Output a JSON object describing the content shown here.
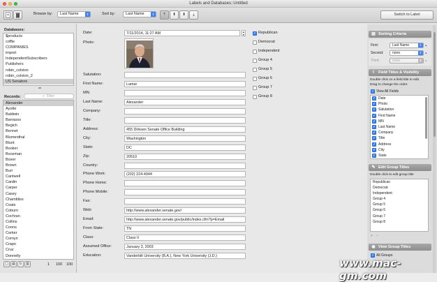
{
  "window": {
    "title": "Labels and Databases::Untitled"
  },
  "toolbar": {
    "browse_by_label": "Browse by:",
    "browse_by_value": "Last Name",
    "sort_by_label": "Sort by:",
    "sort_by_value": "Last Name",
    "switch_label": "Switch to Label"
  },
  "databases": {
    "header": "Databases:",
    "items": [
      "$products",
      "coffie",
      "COMPANIES",
      "import",
      "IndependentSubscribers",
      "Publishers",
      "robin_colston",
      "robin_colston_2",
      "US Senators"
    ],
    "selected": "US Senators"
  },
  "records": {
    "header": "Records:",
    "filter_placeholder": "Filter",
    "items": [
      "Alexander",
      "Ayotte",
      "Baldwin",
      "Barrasso",
      "Begich",
      "Bennet",
      "Blumenthal",
      "Blunt",
      "Booker",
      "Boozman",
      "Boxer",
      "Brown",
      "Burr",
      "Cantwell",
      "Cardin",
      "Carper",
      "Casey",
      "Chambliss",
      "Coats",
      "Coburn",
      "Cochran",
      "Collins",
      "Coons",
      "Corker",
      "Cornyn",
      "Crapo",
      "Cruz",
      "Donnelly"
    ],
    "selected": "Alexander",
    "footer": {
      "count": "1",
      "total": "100",
      "of": "100"
    }
  },
  "record": {
    "date_label": "Date:",
    "date_value": "7/11/2014, 11:27 AM",
    "photo_label": "Photo:",
    "fields": [
      {
        "label": "Salutation:",
        "value": ""
      },
      {
        "label": "First Name:",
        "value": "Lamar"
      },
      {
        "label": "MN:",
        "value": ""
      },
      {
        "label": "Last Name:",
        "value": "Alexander"
      },
      {
        "label": "Company:",
        "value": ""
      },
      {
        "label": "Title:",
        "value": ""
      },
      {
        "label": "Address:",
        "value": "455 Dirksen Senate Office Building"
      },
      {
        "label": "City:",
        "value": "Washington"
      },
      {
        "label": "State:",
        "value": "DC"
      },
      {
        "label": "Zip:",
        "value": "20510"
      },
      {
        "label": "Country:",
        "value": ""
      },
      {
        "label": "Phone Work:",
        "value": "(202) 224-4944"
      },
      {
        "label": "Phone Home:",
        "value": ""
      },
      {
        "label": "Phone Mobile:",
        "value": ""
      },
      {
        "label": "Fax:",
        "value": ""
      },
      {
        "label": "Web:",
        "value": "http://www.alexander.senate.gov/"
      },
      {
        "label": "Email:",
        "value": "http://www.alexander.senate.gov/public/index.cfm?p=Email"
      },
      {
        "label": "From State:",
        "value": "TN"
      },
      {
        "label": "Class:",
        "value": "Class II"
      },
      {
        "label": "Assumed Office:",
        "value": "January 3, 2003"
      },
      {
        "label": "Education:",
        "value": "Vanderbilt University (B.A.), New York University (J.D.)"
      }
    ],
    "groups": [
      {
        "label": "Republican",
        "checked": true
      },
      {
        "label": "Democrat",
        "checked": false
      },
      {
        "label": "Independent",
        "checked": false
      },
      {
        "label": "Group 4",
        "checked": false
      },
      {
        "label": "Group 5",
        "checked": false
      },
      {
        "label": "Group 6",
        "checked": false
      },
      {
        "label": "Group 7",
        "checked": false
      },
      {
        "label": "Group 8",
        "checked": false
      }
    ]
  },
  "right": {
    "sorting": {
      "header": "Sorting Criteria",
      "first_label": "First:",
      "first_value": "Last Name",
      "second_label": "Second:",
      "second_value": "none",
      "third_label": "Third:",
      "third_value": "none"
    },
    "field_titles": {
      "header": "Field Titles & Visibility",
      "help1": "Double click on a field title to edit.",
      "help2": "Drag to change the order.",
      "view_all": "View All Fields",
      "items": [
        "Date",
        "Photo",
        "Salutation",
        "First Name",
        "MN",
        "Last Name",
        "Company",
        "Title",
        "Address",
        "City",
        "State"
      ]
    },
    "group_titles": {
      "header": "Edit Group Titles",
      "help": "Double click to edit group title",
      "items": [
        "Republican",
        "Democrat",
        "Independent",
        "Group 4",
        "Group 5",
        "Group 6",
        "Group 7",
        "Group 8"
      ]
    },
    "view_groups": {
      "header": "View Group Titles",
      "all_groups": "All Groups"
    }
  },
  "watermark": "www.mac-gm.com"
}
